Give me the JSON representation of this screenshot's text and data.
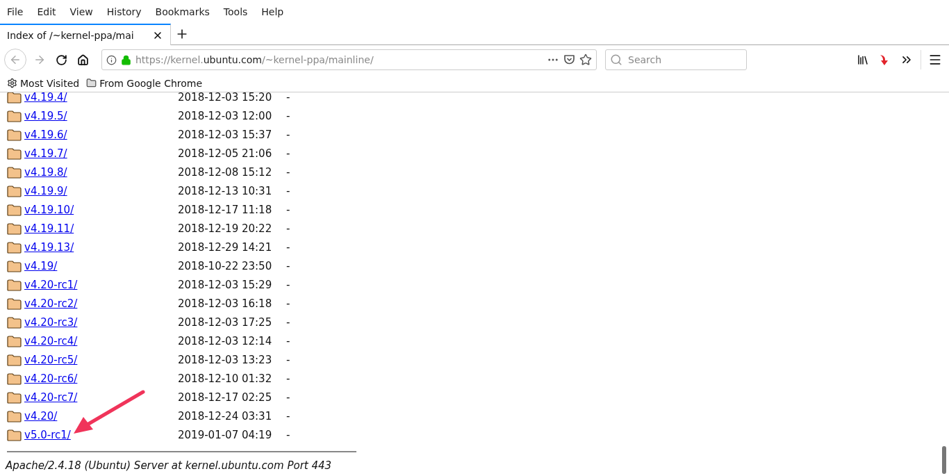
{
  "menu": [
    "File",
    "Edit",
    "View",
    "History",
    "Bookmarks",
    "Tools",
    "Help"
  ],
  "tab": {
    "title": "Index of /~kernel-ppa/mai"
  },
  "url": "https://kernel.**ubuntu.com**/~kernel-ppa/mainline/",
  "search": {
    "placeholder": "Search"
  },
  "bookmarks": [
    {
      "kind": "smart",
      "label": "Most Visited"
    },
    {
      "kind": "folder",
      "label": "From Google Chrome"
    }
  ],
  "listing": [
    {
      "name": "v4.19.4/",
      "date": "2018-12-03 15:20",
      "size": "-"
    },
    {
      "name": "v4.19.5/",
      "date": "2018-12-03 12:00",
      "size": "-"
    },
    {
      "name": "v4.19.6/",
      "date": "2018-12-03 15:37",
      "size": "-"
    },
    {
      "name": "v4.19.7/",
      "date": "2018-12-05 21:06",
      "size": "-"
    },
    {
      "name": "v4.19.8/",
      "date": "2018-12-08 15:12",
      "size": "-"
    },
    {
      "name": "v4.19.9/",
      "date": "2018-12-13 10:31",
      "size": "-"
    },
    {
      "name": "v4.19.10/",
      "date": "2018-12-17 11:18",
      "size": "-"
    },
    {
      "name": "v4.19.11/",
      "date": "2018-12-19 20:22",
      "size": "-"
    },
    {
      "name": "v4.19.13/",
      "date": "2018-12-29 14:21",
      "size": "-"
    },
    {
      "name": "v4.19/",
      "date": "2018-10-22 23:50",
      "size": "-"
    },
    {
      "name": "v4.20-rc1/",
      "date": "2018-12-03 15:29",
      "size": "-"
    },
    {
      "name": "v4.20-rc2/",
      "date": "2018-12-03 16:18",
      "size": "-"
    },
    {
      "name": "v4.20-rc3/",
      "date": "2018-12-03 17:25",
      "size": "-"
    },
    {
      "name": "v4.20-rc4/",
      "date": "2018-12-03 12:14",
      "size": "-"
    },
    {
      "name": "v4.20-rc5/",
      "date": "2018-12-03 13:23",
      "size": "-"
    },
    {
      "name": "v4.20-rc6/",
      "date": "2018-12-10 01:32",
      "size": "-"
    },
    {
      "name": "v4.20-rc7/",
      "date": "2018-12-17 02:25",
      "size": "-"
    },
    {
      "name": "v4.20/",
      "date": "2018-12-24 03:31",
      "size": "-"
    },
    {
      "name": "v5.0-rc1/",
      "date": "2019-01-07 04:19",
      "size": "-"
    }
  ],
  "footer": "Apache/2.4.18 (Ubuntu) Server at kernel.ubuntu.com Port 443"
}
